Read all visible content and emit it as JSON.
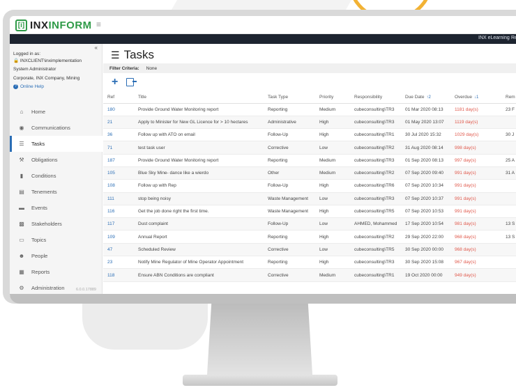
{
  "header": {
    "logo_mark": "[i]",
    "logo_prefix": "INX",
    "logo_suffix": "INFORM",
    "nav_links": [
      "INX eLearning",
      "Re"
    ]
  },
  "sidebar": {
    "logged_in_label": "Logged in as:",
    "username": "INXCLIENT\\inximplementation",
    "role": "System Administrator",
    "org": "Corporate, INX Company, Mining",
    "help_label": "Online Help",
    "items": [
      {
        "label": "Home",
        "icon": "home-icon"
      },
      {
        "label": "Communications",
        "icon": "chat-icon"
      },
      {
        "label": "Tasks",
        "icon": "list-icon",
        "active": true
      },
      {
        "label": "Obligations",
        "icon": "gavel-icon"
      },
      {
        "label": "Conditions",
        "icon": "document-icon"
      },
      {
        "label": "Tenements",
        "icon": "map-icon"
      },
      {
        "label": "Events",
        "icon": "folder-icon"
      },
      {
        "label": "Stakeholders",
        "icon": "contact-card-icon"
      },
      {
        "label": "Topics",
        "icon": "book-icon"
      },
      {
        "label": "People",
        "icon": "people-icon"
      },
      {
        "label": "Reports",
        "icon": "reports-icon"
      },
      {
        "label": "Administration",
        "icon": "gear-icon"
      }
    ],
    "version": "6.0.0.17889"
  },
  "main": {
    "title": "Tasks",
    "filter_label": "Filter Criteria:",
    "filter_value": "None",
    "columns": [
      "Ref",
      "Title",
      "Task Type",
      "Priority",
      "Responsibility",
      "Due Date",
      "Overdue",
      "Rem"
    ],
    "due_sort": "↑2",
    "overdue_sort": "↓1",
    "rows": [
      {
        "ref": "180",
        "title": "Provide Ground Water Monitoring report",
        "type": "Reporting",
        "priority": "Medium",
        "resp": "cubeconsulting\\TR3",
        "due": "01 Mar 2020 08:13",
        "overdue": "1181 day(s)",
        "rem": "23 F"
      },
      {
        "ref": "21",
        "title": "Apply to Minister for New GL Licence for > 10 hectares",
        "type": "Administrative",
        "priority": "High",
        "resp": "cubeconsulting\\TR3",
        "due": "01 May 2020 13:07",
        "overdue": "1119 day(s)",
        "rem": ""
      },
      {
        "ref": "36",
        "title": "Follow up with ATO on email",
        "type": "Follow-Up",
        "priority": "High",
        "resp": "cubeconsulting\\TR1",
        "due": "30 Jul 2020 15:32",
        "overdue": "1029 day(s)",
        "rem": "30 J"
      },
      {
        "ref": "71",
        "title": "test task user",
        "type": "Corrective",
        "priority": "Low",
        "resp": "cubeconsulting\\TR2",
        "due": "31 Aug 2020 08:14",
        "overdue": "998 day(s)",
        "rem": ""
      },
      {
        "ref": "187",
        "title": "Provide Ground Water Monitoring report",
        "type": "Reporting",
        "priority": "Medium",
        "resp": "cubeconsulting\\TR3",
        "due": "01 Sep 2020 08:13",
        "overdue": "997 day(s)",
        "rem": "25 A"
      },
      {
        "ref": "105",
        "title": "Blue Sky Mine- dance like a wierdo",
        "type": "Other",
        "priority": "Medium",
        "resp": "cubeconsulting\\TR2",
        "due": "07 Sep 2020 09:40",
        "overdue": "991 day(s)",
        "rem": "31 A"
      },
      {
        "ref": "108",
        "title": "Follow up with Rep",
        "type": "Follow-Up",
        "priority": "High",
        "resp": "cubeconsulting\\TR6",
        "due": "07 Sep 2020 10:34",
        "overdue": "991 day(s)",
        "rem": ""
      },
      {
        "ref": "111",
        "title": "stop being noisy",
        "type": "Waste Management",
        "priority": "Low",
        "resp": "cubeconsulting\\TR3",
        "due": "07 Sep 2020 10:37",
        "overdue": "991 day(s)",
        "rem": ""
      },
      {
        "ref": "116",
        "title": "Get the job done right the first time.",
        "type": "Waste Management",
        "priority": "High",
        "resp": "cubeconsulting\\TR5",
        "due": "07 Sep 2020 10:53",
        "overdue": "991 day(s)",
        "rem": ""
      },
      {
        "ref": "117",
        "title": "Dust complaint",
        "type": "Follow-Up",
        "priority": "Low",
        "resp": "AHMED, Mohammed",
        "due": "17 Sep 2020 10:54",
        "overdue": "981 day(s)",
        "rem": "13 S"
      },
      {
        "ref": "109",
        "title": "Annual Report",
        "type": "Reporting",
        "priority": "High",
        "resp": "cubeconsulting\\TR2",
        "due": "29 Sep 2020 22:00",
        "overdue": "968 day(s)",
        "rem": "13 S"
      },
      {
        "ref": "47",
        "title": "Scheduled Review",
        "type": "Corrective",
        "priority": "Low",
        "resp": "cubeconsulting\\TR5",
        "due": "30 Sep 2020 00:00",
        "overdue": "968 day(s)",
        "rem": ""
      },
      {
        "ref": "23",
        "title": "Notify Mine Regulator of Mine Operator Appointment",
        "type": "Reporting",
        "priority": "High",
        "resp": "cubeconsulting\\TR3",
        "due": "30 Sep 2020 15:08",
        "overdue": "967 day(s)",
        "rem": ""
      },
      {
        "ref": "118",
        "title": "Ensure ABN Conditions are compliant",
        "type": "Corrective",
        "priority": "Medium",
        "resp": "cubeconsulting\\TR1",
        "due": "19 Oct 2020 00:00",
        "overdue": "949 day(s)",
        "rem": ""
      }
    ]
  },
  "colors": {
    "brand_green": "#2e9a47",
    "link_blue": "#2a6db5",
    "overdue_red": "#e0584b",
    "navbar": "#1d2430",
    "accent_ring": "#f2b234"
  }
}
